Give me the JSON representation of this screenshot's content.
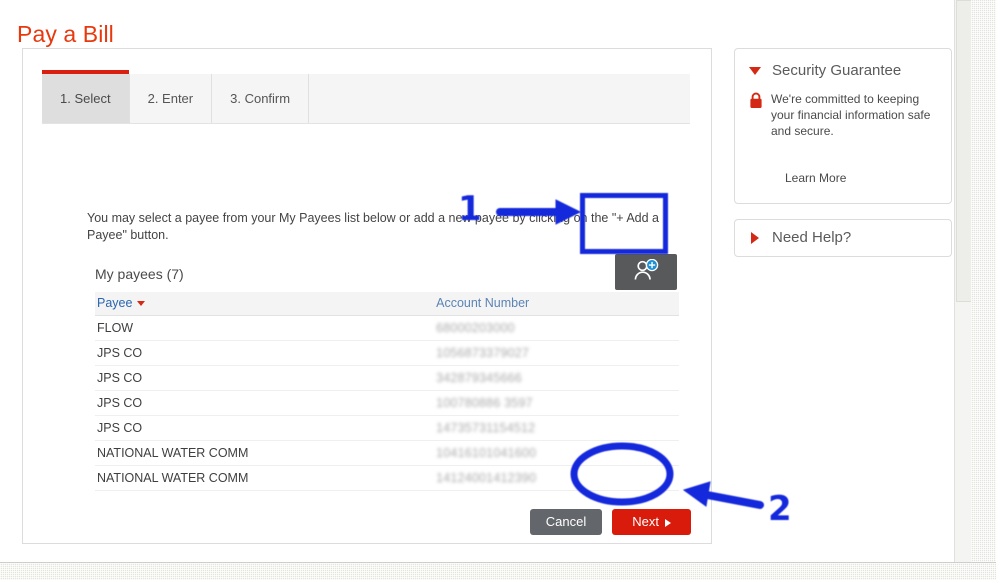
{
  "page": {
    "title": "Pay a Bill"
  },
  "tabs": [
    {
      "label": "1. Select",
      "active": true
    },
    {
      "label": "2. Enter",
      "active": false
    },
    {
      "label": "3. Confirm",
      "active": false
    }
  ],
  "instructions": "You may select a payee from your My Payees list below or add a new payee by clicking on the \"+ Add a Payee\" button.",
  "payees_section": {
    "heading": "My payees (7)",
    "add_payee_button_icon": "add-person-icon",
    "columns": [
      "Payee",
      "Account Number"
    ],
    "sort_column": "Payee",
    "sort_direction": "descending",
    "rows": [
      {
        "payee": "FLOW",
        "account_number": "68000203000"
      },
      {
        "payee": "JPS CO",
        "account_number": "1056873379027"
      },
      {
        "payee": "JPS CO",
        "account_number": "342879345666"
      },
      {
        "payee": "JPS CO",
        "account_number": "100780886 3597"
      },
      {
        "payee": "JPS CO",
        "account_number": "14735731154512"
      },
      {
        "payee": "NATIONAL WATER COMM",
        "account_number": "10416101041600"
      },
      {
        "payee": "NATIONAL WATER COMM",
        "account_number": "14124001412390"
      }
    ]
  },
  "actions": {
    "cancel_label": "Cancel",
    "next_label": "Next"
  },
  "sidebar": {
    "security": {
      "title": "Security Guarantee",
      "body": "We're committed to keeping your financial information safe and secure.",
      "link": "Learn More",
      "icon": "lock-icon",
      "expanded": true
    },
    "help": {
      "title": "Need Help?",
      "expanded": false
    }
  },
  "annotations": [
    {
      "label": "1",
      "target": "add-payee-button"
    },
    {
      "label": "2",
      "target": "next-button"
    }
  ],
  "colors": {
    "brand_red": "#d81b0b",
    "title_red": "#e8380d",
    "annotation_blue": "#1428dc",
    "link_blue": "#2a66b0",
    "button_gray": "#63666a"
  }
}
